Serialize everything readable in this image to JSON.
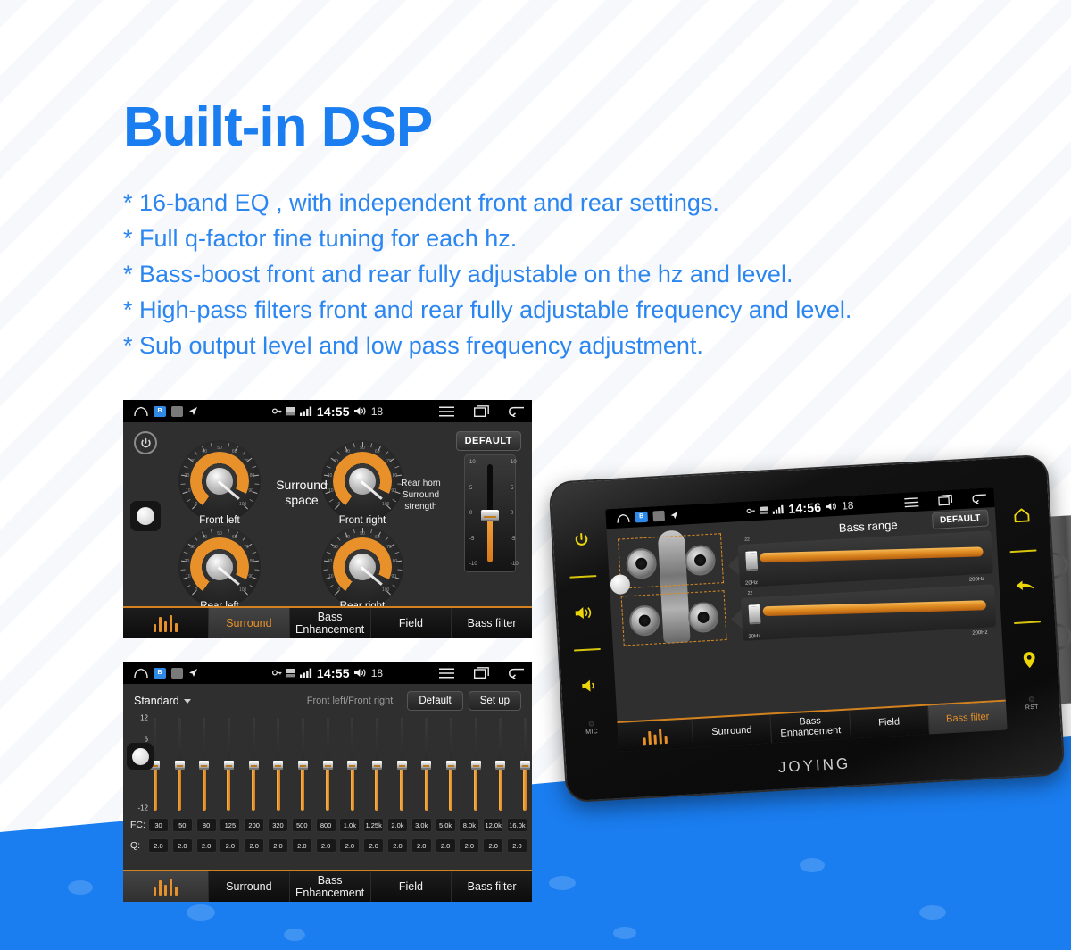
{
  "headline": "Built-in DSP",
  "bullets": [
    "* 16-band EQ , with independent front and rear settings.",
    "* Full q-factor fine tuning for each hz.",
    "* Bass-boost front and rear fully adjustable on the hz and level.",
    "* High-pass filters front and rear fully adjustable frequency and level.",
    "* Sub output level and  low pass frequency adjustment."
  ],
  "colors": {
    "brand_blue": "#1a7df0",
    "text_blue": "#2b86f0",
    "accent_orange": "#e8912a",
    "wave_blue": "#1a7df0",
    "device_yellow": "#ecd60a"
  },
  "status_bar": {
    "time_surround": "14:55",
    "time_eq": "14:55",
    "time_device": "14:56",
    "volume": "18",
    "icons": [
      "home-icon",
      "app-badge-blue-icon",
      "app-badge-grey-icon",
      "navigation-arrow-icon",
      "key-icon",
      "data-transfer-icon",
      "signal-bars-icon",
      "speaker-icon",
      "menu-icon",
      "recents-icon",
      "back-icon"
    ]
  },
  "tabs": {
    "eq": "EQ",
    "surround": "Surround",
    "bass_enhancement_line1": "Bass",
    "bass_enhancement_line2": "Enhancement",
    "field": "Field",
    "bass_filter": "Bass filter"
  },
  "surround_screen": {
    "default_button": "DEFAULT",
    "knobs": [
      {
        "label": "Front left",
        "value": 96
      },
      {
        "label": "Front right",
        "value": 96
      },
      {
        "label": "Rear left",
        "value": 96
      },
      {
        "label": "Rear right",
        "value": 96
      }
    ],
    "knob_scale": [
      "0",
      "10",
      "20",
      "30",
      "40",
      "50",
      "60",
      "70",
      "80",
      "90",
      "100"
    ],
    "center_label_line1": "Surround",
    "center_label_line2": "space",
    "right_label_line1": "Rear horn",
    "right_label_line2": "Surround",
    "right_label_line3": "strength",
    "vertical_slider": {
      "scale": [
        "10",
        "5",
        "0",
        "-5",
        "-10"
      ],
      "value": -2
    },
    "active_tab": "Surround"
  },
  "eq_screen": {
    "preset": "Standard",
    "channel_label": "Front left/Front right",
    "default_button": "Default",
    "setup_button": "Set up",
    "scale": [
      "12",
      "6",
      "0",
      "-12"
    ],
    "row_labels": {
      "fc": "FC:",
      "q": "Q:"
    },
    "bands": [
      {
        "fc": "30",
        "q": "2.0",
        "gain": 0
      },
      {
        "fc": "50",
        "q": "2.0",
        "gain": 0
      },
      {
        "fc": "80",
        "q": "2.0",
        "gain": 0
      },
      {
        "fc": "125",
        "q": "2.0",
        "gain": 0
      },
      {
        "fc": "200",
        "q": "2.0",
        "gain": 0
      },
      {
        "fc": "320",
        "q": "2.0",
        "gain": 0
      },
      {
        "fc": "500",
        "q": "2.0",
        "gain": 0
      },
      {
        "fc": "800",
        "q": "2.0",
        "gain": 0
      },
      {
        "fc": "1.0k",
        "q": "2.0",
        "gain": 0
      },
      {
        "fc": "1.25k",
        "q": "2.0",
        "gain": 0
      },
      {
        "fc": "2.0k",
        "q": "2.0",
        "gain": 0
      },
      {
        "fc": "3.0k",
        "q": "2.0",
        "gain": 0
      },
      {
        "fc": "5.0k",
        "q": "2.0",
        "gain": 0
      },
      {
        "fc": "8.0k",
        "q": "2.0",
        "gain": 0
      },
      {
        "fc": "12.0k",
        "q": "2.0",
        "gain": 0
      },
      {
        "fc": "16.0k",
        "q": "2.0",
        "gain": 0
      }
    ],
    "active_tab": "EQ"
  },
  "device": {
    "brand": "JOYING",
    "title": "Bass range",
    "default_button": "DEFAULT",
    "active_tab": "Bass filter",
    "sliders": [
      {
        "handle_value": "22",
        "min_label": "20Hz",
        "max_label": "200Hz"
      },
      {
        "handle_value": "22",
        "min_label": "20Hz",
        "max_label": "200Hz"
      }
    ],
    "left_buttons": [
      "power-icon",
      "volume-up-icon",
      "volume-down-icon"
    ],
    "right_buttons": [
      "home-icon",
      "back-arrow-icon",
      "location-pin-icon"
    ],
    "mic_label": "MIC",
    "reset_label": "RST"
  }
}
